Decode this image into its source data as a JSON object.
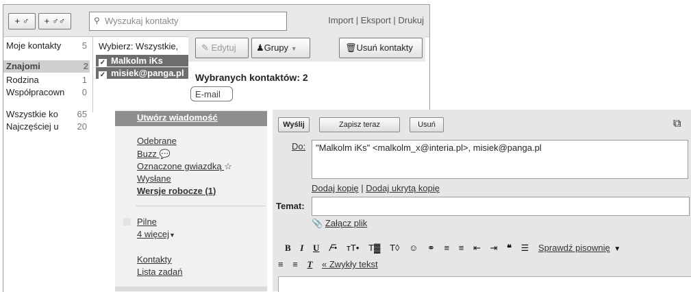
{
  "contacts": {
    "add_contact": "+ ♂",
    "add_group": "+ ♂♂",
    "search_placeholder": "Wyszukaj kontakty",
    "import": "Import",
    "export": "Eksport",
    "print": "Drukuj",
    "groups": [
      {
        "label": "Moje kontakty",
        "count": "5"
      },
      {
        "label": "Znajomi",
        "count": "2"
      },
      {
        "label": "Rodzina",
        "count": "1"
      },
      {
        "label": "Współpracown",
        "count": "0"
      },
      {
        "label": "Wszystkie ko",
        "count": "65"
      },
      {
        "label": "Najczęściej u",
        "count": "20"
      }
    ],
    "select_label": "Wybierz: Wszystkie,",
    "rows": [
      "Malkolm iKs",
      "misiek@panga.pl"
    ],
    "edit": "Edytuj",
    "groups_btn": "Grupy",
    "delete": "Usuń kontakty",
    "selected_count": "Wybranych kontaktów: 2",
    "email_btn": "E-mail"
  },
  "nav": {
    "compose": "Utwórz wiadomość",
    "inbox": "Odebrane",
    "buzz": "Buzz",
    "starred": "Oznaczone gwiazdką",
    "sent": "Wysłane",
    "drafts": "Wersje robocze (1)",
    "urgent": "Pilne",
    "more": "4 więcej",
    "contacts": "Kontakty",
    "tasks": "Lista zadań"
  },
  "compose": {
    "send": "Wyślij",
    "save": "Zapisz teraz",
    "discard": "Usuń",
    "to_label": "Do:",
    "to_value": "\"Malkolm iKs\" <malkolm_x@interia.pl>,  misiek@panga.pl",
    "add_cc": "Dodaj kopię",
    "add_bcc": "Dodaj ukrytą kopię",
    "subject_label": "Temat:",
    "subject_value": "",
    "attach": "Załącz plik",
    "spellcheck": "Sprawdź pisownię",
    "plain_text": "« Zwykły tekst"
  }
}
